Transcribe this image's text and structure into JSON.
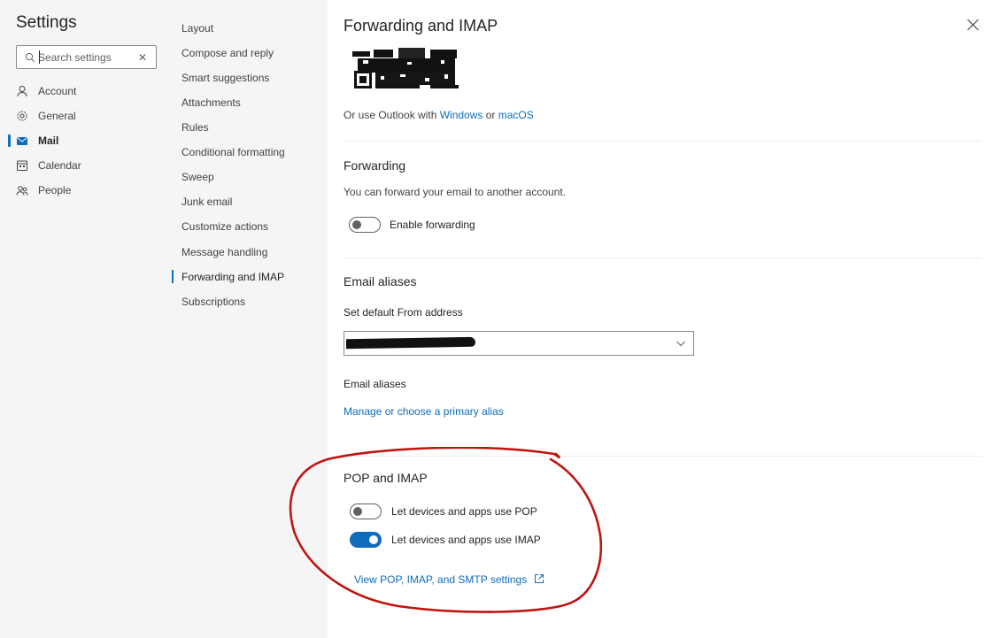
{
  "settings": {
    "title": "Settings",
    "search_placeholder": "Search settings"
  },
  "categories": [
    {
      "label": "Account",
      "icon": "person-icon"
    },
    {
      "label": "General",
      "icon": "gear-icon"
    },
    {
      "label": "Mail",
      "icon": "mail-icon",
      "active": true
    },
    {
      "label": "Calendar",
      "icon": "calendar-icon"
    },
    {
      "label": "People",
      "icon": "people-icon"
    }
  ],
  "mail_nav": [
    {
      "label": "Layout"
    },
    {
      "label": "Compose and reply"
    },
    {
      "label": "Smart suggestions"
    },
    {
      "label": "Attachments"
    },
    {
      "label": "Rules"
    },
    {
      "label": "Conditional formatting"
    },
    {
      "label": "Sweep"
    },
    {
      "label": "Junk email"
    },
    {
      "label": "Customize actions"
    },
    {
      "label": "Message handling"
    },
    {
      "label": "Forwarding and IMAP",
      "active": true
    },
    {
      "label": "Subscriptions"
    }
  ],
  "main": {
    "title": "Forwarding and IMAP",
    "outlook_line": {
      "prefix": "Or use Outlook with ",
      "windows": "Windows",
      "or": " or ",
      "macos": "macOS"
    },
    "forwarding": {
      "title": "Forwarding",
      "description": "You can forward your email to another account.",
      "toggle_label": "Enable forwarding",
      "enabled": false
    },
    "aliases": {
      "title": "Email aliases",
      "default_from_label": "Set default From address",
      "aliases_label": "Email aliases",
      "manage_link": "Manage or choose a primary alias"
    },
    "pop_imap": {
      "title": "POP and IMAP",
      "pop_label": "Let devices and apps use POP",
      "pop_enabled": false,
      "imap_label": "Let devices and apps use IMAP",
      "imap_enabled": true,
      "settings_link": "View POP, IMAP, and SMTP settings"
    }
  },
  "colors": {
    "accent": "#0f6cbd",
    "nav_bg": "#f5f5f5",
    "annotation": "#c0140f"
  }
}
